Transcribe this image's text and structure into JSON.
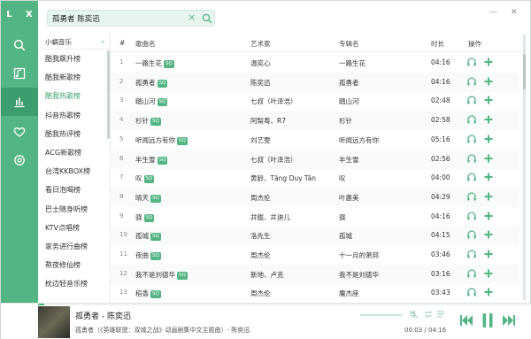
{
  "app": {
    "logo": "L X"
  },
  "search": {
    "value": "孤勇者 陈奕迅"
  },
  "window": {
    "minimize": "—",
    "close": "✕"
  },
  "sidebar": {
    "source": "小蜗音乐",
    "items": [
      {
        "label": "酷我飙升榜",
        "active": false
      },
      {
        "label": "酷我新歌榜",
        "active": false
      },
      {
        "label": "酷我热歌榜",
        "active": true
      },
      {
        "label": "抖音热歌榜",
        "active": false
      },
      {
        "label": "酷我热评榜",
        "active": false
      },
      {
        "label": "ACG新歌榜",
        "active": false
      },
      {
        "label": "台湾KKBOX榜",
        "active": false
      },
      {
        "label": "看日泡喝榜",
        "active": false
      },
      {
        "label": "巴士随身听榜",
        "active": false
      },
      {
        "label": "KTV点唱榜",
        "active": false
      },
      {
        "label": "家务进行曲榜",
        "active": false
      },
      {
        "label": "熬夜修仙榜",
        "active": false
      },
      {
        "label": "枕边轻音乐榜",
        "active": false
      }
    ]
  },
  "table": {
    "headers": {
      "num": "#",
      "song": "歌曲名",
      "artist": "艺术家",
      "album": "专辑名",
      "duration": "时长",
      "actions": "操作"
    },
    "quality_badge": "SQ",
    "rows": [
      {
        "num": "1",
        "song": "一路生花",
        "sq": true,
        "artist": "温奕心",
        "album": "一路生花",
        "duration": "04:16"
      },
      {
        "num": "2",
        "song": "孤勇者",
        "sq": true,
        "artist": "陈奕迅",
        "album": "孤勇者",
        "duration": "04:16"
      },
      {
        "num": "3",
        "song": "踏山河",
        "sq": true,
        "artist": "七叔（叶泽浩）",
        "album": "踏山河",
        "duration": "02:48"
      },
      {
        "num": "4",
        "song": "杉针",
        "sq": true,
        "artist": "阿梨粤、R7",
        "album": "杉针",
        "duration": "02:58"
      },
      {
        "num": "5",
        "song": "听闻远方有你",
        "sq": true,
        "artist": "刘艺雯",
        "album": "听闻远方有你",
        "duration": "05:16"
      },
      {
        "num": "6",
        "song": "半生雪",
        "sq": true,
        "artist": "七叔（叶泽浩）",
        "album": "半生雪",
        "duration": "02:56"
      },
      {
        "num": "7",
        "song": "叹",
        "sq": true,
        "artist": "黄龄、Tăng Duy Tân",
        "album": "叹",
        "duration": "04:00"
      },
      {
        "num": "8",
        "song": "晴天",
        "sq": true,
        "artist": "周杰伦",
        "album": "叶惠美",
        "duration": "04:29"
      },
      {
        "num": "9",
        "song": "骁",
        "sq": true,
        "artist": "井胧、井迪儿",
        "album": "骁",
        "duration": "04:16"
      },
      {
        "num": "10",
        "song": "孤城",
        "sq": true,
        "artist": "洛先生",
        "album": "孤城",
        "duration": "04:15"
      },
      {
        "num": "11",
        "song": "夜曲",
        "sq": true,
        "artist": "周杰伦",
        "album": "十一月的萧邦",
        "duration": "03:46"
      },
      {
        "num": "12",
        "song": "我不是刘德华",
        "sq": true,
        "artist": "新地、卢克",
        "album": "我不是刘德华",
        "duration": "03:16"
      },
      {
        "num": "13",
        "song": "稻香",
        "sq": true,
        "artist": "周杰伦",
        "album": "魔杰座",
        "duration": "03:43"
      }
    ]
  },
  "player": {
    "title": "孤勇者 - 陈奕迅",
    "subtitle": "孤勇者（《英雄联盟：双城之战》动画剧集中文主题曲）- 陈奕迅",
    "time": "00:03 / 04:16",
    "progress": 0.012
  },
  "colors": {
    "accent": "#52b583",
    "accent_dark": "#3e9d6e"
  }
}
